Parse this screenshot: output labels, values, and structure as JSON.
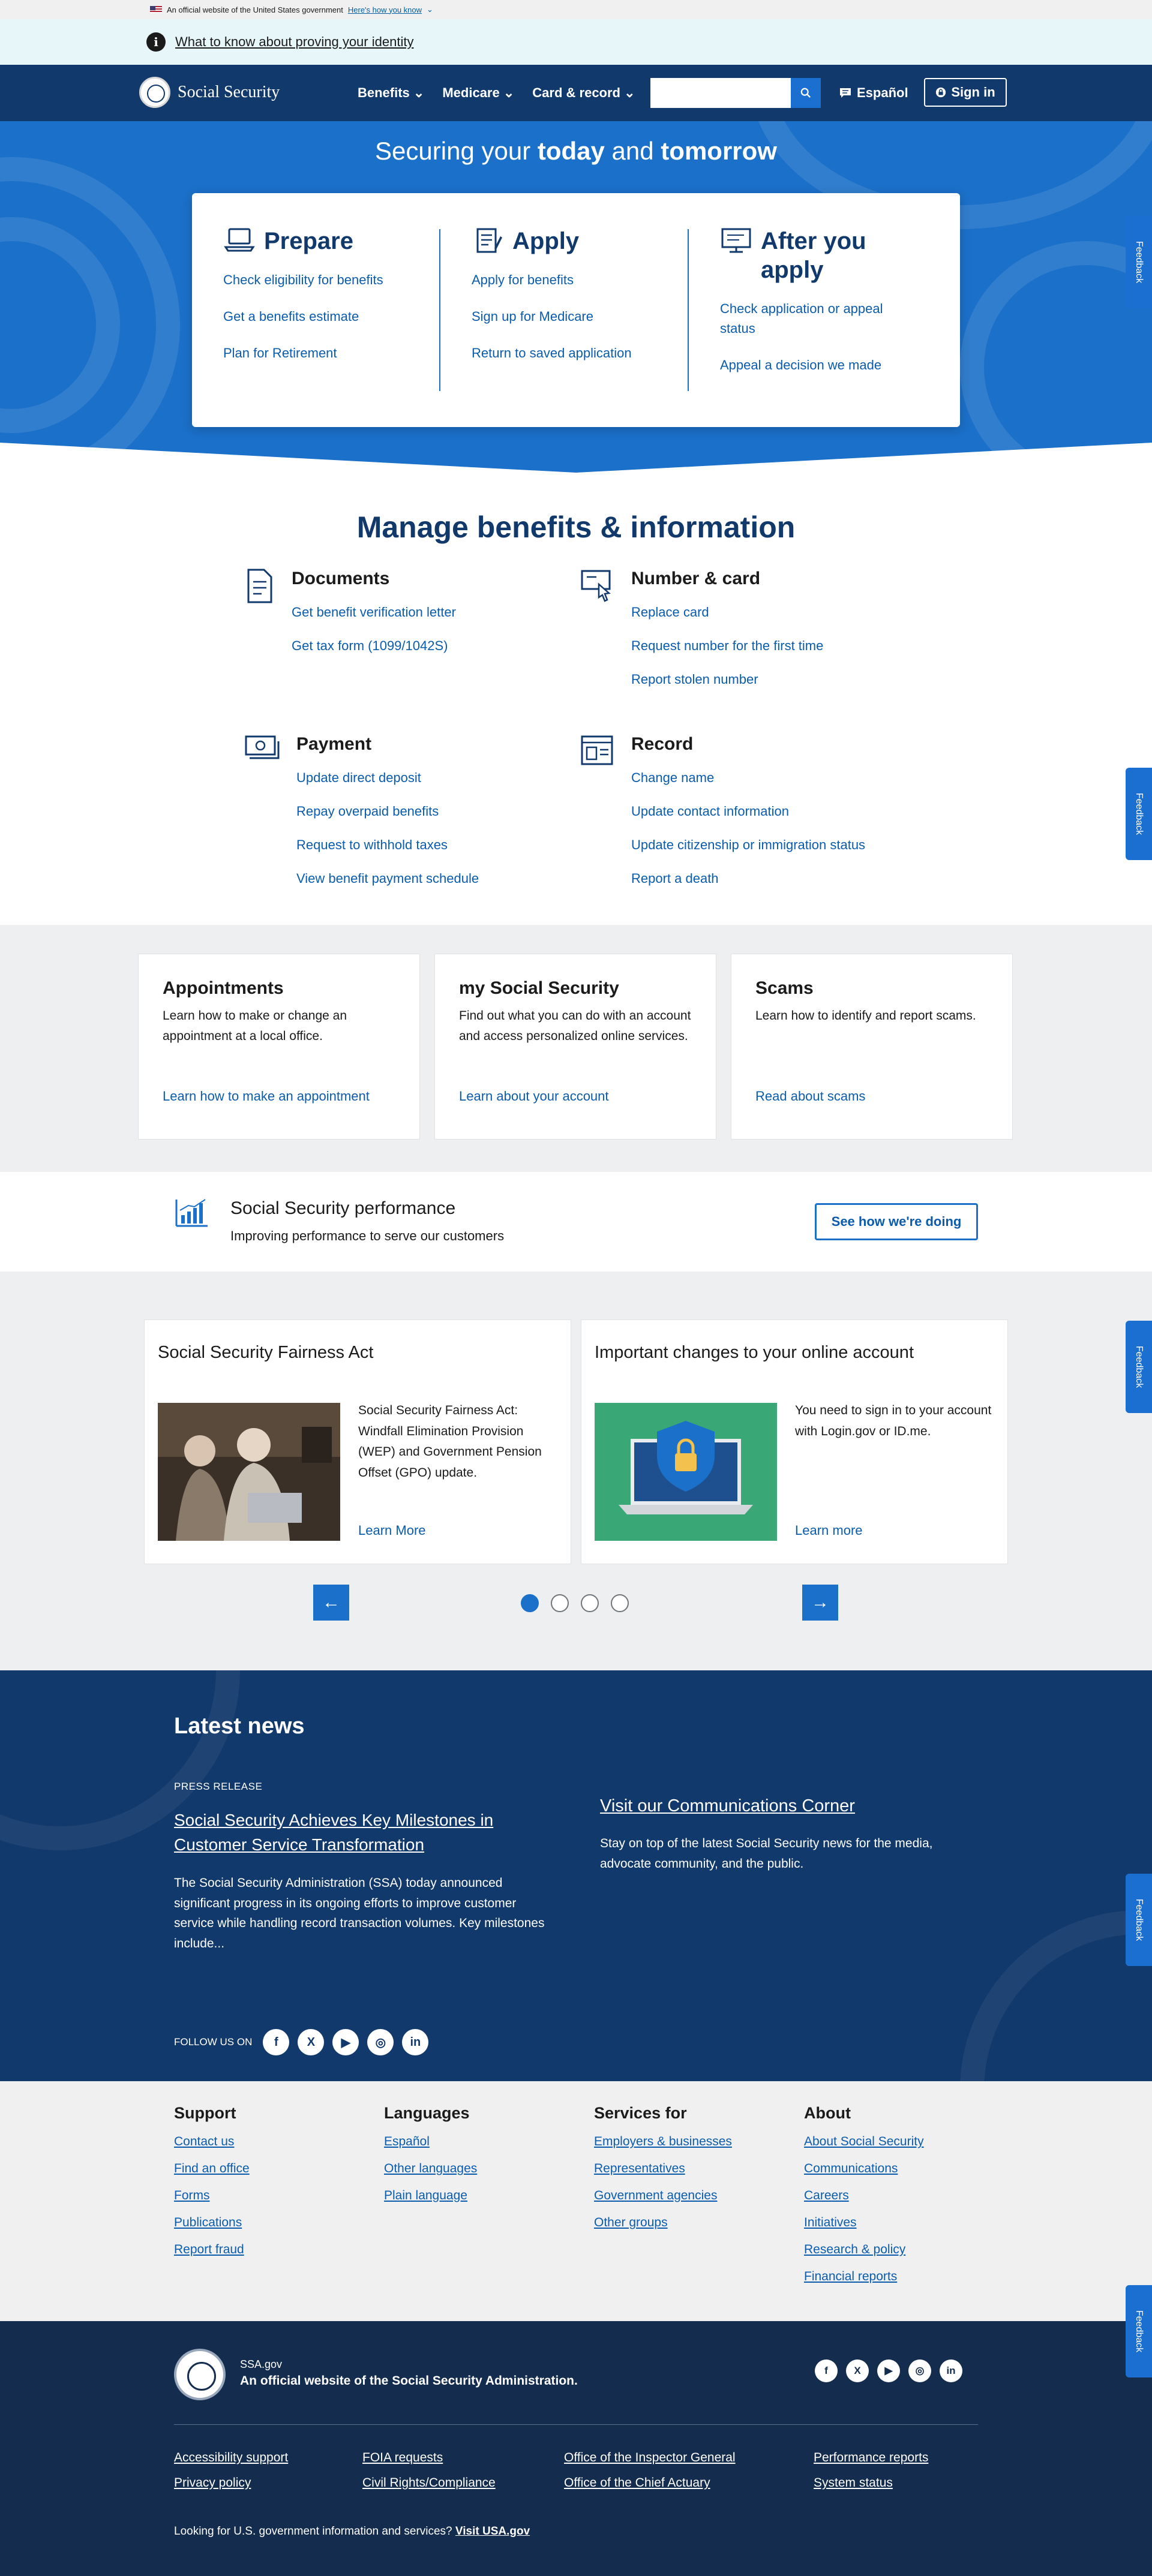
{
  "gov_banner": {
    "text": "An official website of the United States government",
    "link": "Here's how you know"
  },
  "alert": {
    "link": "What to know about proving your identity"
  },
  "header": {
    "logo_text": "Social Security",
    "nav": [
      "Benefits",
      "Medicare",
      "Card & record"
    ],
    "search_placeholder": "",
    "espanol": "Español",
    "signin": "Sign in"
  },
  "hero": {
    "title_pre": "Securing your ",
    "title_b1": "today",
    "title_mid": " and ",
    "title_b2": "tomorrow",
    "columns": [
      {
        "title": "Prepare",
        "icon": "laptop-icon",
        "links": [
          "Check eligibility for benefits",
          "Get a benefits estimate",
          "Plan for Retirement"
        ]
      },
      {
        "title": "Apply",
        "icon": "form-icon",
        "links": [
          "Apply for benefits",
          "Sign up for Medicare",
          "Return to saved application"
        ]
      },
      {
        "title": "After you apply",
        "icon": "monitor-icon",
        "links": [
          "Check application or appeal status",
          "Appeal a decision we made"
        ]
      }
    ]
  },
  "manage": {
    "title": "Manage benefits & information",
    "groups": [
      {
        "title": "Documents",
        "icon": "document-icon",
        "links": [
          "Get benefit verification letter",
          "Get tax form (1099/1042S)"
        ]
      },
      {
        "title": "Number & card",
        "icon": "card-icon",
        "links": [
          "Replace card",
          "Request number for the first time",
          "Report stolen number"
        ]
      },
      {
        "title": "Payment",
        "icon": "money-icon",
        "links": [
          "Update direct deposit",
          "Repay overpaid benefits",
          "Request to withhold taxes",
          "View benefit payment schedule"
        ]
      },
      {
        "title": "Record",
        "icon": "id-record-icon",
        "links": [
          "Change name",
          "Update contact information",
          "Update citizenship or immigration status",
          "Report a death"
        ]
      }
    ]
  },
  "promos": [
    {
      "title": "Appointments",
      "text": "Learn how to make or change an appointment at a local office.",
      "link": "Learn how to make an appointment"
    },
    {
      "title": "my Social Security",
      "text": "Find out what you can do with an account and access personalized online services.",
      "link": "Learn about your account"
    },
    {
      "title": "Scams",
      "text": "Learn how to identify and report scams.",
      "link": "Read about scams"
    }
  ],
  "performance": {
    "title": "Social Security performance",
    "text": "Improving performance to serve our customers",
    "button": "See how we're doing"
  },
  "carousel": {
    "cards": [
      {
        "title": "Social Security Fairness Act",
        "text": "Social Security Fairness Act: Windfall Elimination Provision (WEP) and Government Pension Offset (GPO) update.",
        "link": "Learn More"
      },
      {
        "title": "Important changes to your online account",
        "text": "You need to sign in to your account with Login.gov or ID.me.",
        "link": "Learn more"
      }
    ],
    "prev": "←",
    "next": "→",
    "dots": 4,
    "active": 0
  },
  "news": {
    "title": "Latest news",
    "label": "PRESS RELEASE",
    "headline": "Social Security Achieves Key Milestones in Customer Service Transformation",
    "body": "The Social Security Administration (SSA) today announced significant progress in its ongoing efforts to improve customer service while handling record transaction volumes. Key milestones include...",
    "comm_link": "Visit our Communications Corner",
    "comm_text": "Stay on top of the latest Social Security news for the media, advocate community, and the public.",
    "follow": "FOLLOW US ON"
  },
  "footer": {
    "columns": [
      {
        "title": "Support",
        "links": [
          "Contact us",
          "Find an office",
          "Forms",
          "Publications",
          "Report fraud"
        ]
      },
      {
        "title": "Languages",
        "links": [
          "Español",
          "Other languages",
          "Plain language"
        ]
      },
      {
        "title": "Services for",
        "links": [
          "Employers & businesses",
          "Representatives",
          "Government agencies",
          "Other groups"
        ]
      },
      {
        "title": "About",
        "links": [
          "About Social Security",
          "Communications",
          "Careers",
          "Initiatives",
          "Research & policy",
          "Financial reports"
        ]
      }
    ],
    "site": "SSA.gov",
    "official": "An official website of the Social Security Administration.",
    "bottom_links": [
      [
        "Accessibility support",
        "Privacy policy"
      ],
      [
        "FOIA requests",
        "Civil Rights/Compliance"
      ],
      [
        "Office of the Inspector General",
        "Office of the Chief Actuary"
      ],
      [
        "Performance reports",
        "System status"
      ]
    ],
    "usa_text": "Looking for U.S. government information and services?",
    "usa_link": "Visit USA.gov"
  },
  "feedback": "Feedback",
  "colors": {
    "primary": "#1b70c9",
    "navy": "#12396b",
    "link": "#0b5cad",
    "footer_bottom": "#142c4d"
  }
}
